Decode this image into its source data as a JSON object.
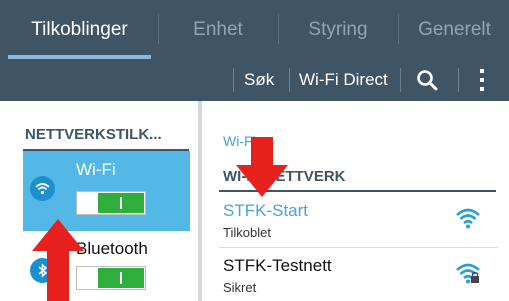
{
  "tabs": [
    {
      "label": "Tilkoblinger",
      "active": true
    },
    {
      "label": "Enhet",
      "active": false
    },
    {
      "label": "Styring",
      "active": false
    },
    {
      "label": "Generelt",
      "active": false
    }
  ],
  "actions": {
    "search_label": "Søk",
    "wifi_direct_label": "Wi-Fi Direct",
    "search_icon": "search-icon",
    "overflow_icon": "more-vert-icon"
  },
  "left_pane": {
    "section_title": "NETTVERKSTILK...",
    "items": [
      {
        "label": "Wi-Fi",
        "icon": "wifi-icon",
        "selected": true,
        "toggle_on": true
      },
      {
        "label": "Bluetooth",
        "icon": "bluetooth-icon",
        "selected": false,
        "toggle_on": true
      }
    ]
  },
  "right_pane": {
    "breadcrumb": "Wi-Fi",
    "section_header": "WI-FI-NETTVERK",
    "networks": [
      {
        "name": "STFK-Start",
        "status": "Tilkoblet",
        "icon": "wifi-signal-icon",
        "connected": true
      },
      {
        "name": "STFK-Testnett",
        "status": "Sikret",
        "icon": "wifi-locked-icon",
        "connected": false
      }
    ]
  },
  "colors": {
    "header_bg": "#3f5566",
    "accent_blue": "#4aa3d6",
    "selected_card": "#54b8e6",
    "toggle_green": "#2fae3e",
    "annotation_red": "#e8211f"
  }
}
